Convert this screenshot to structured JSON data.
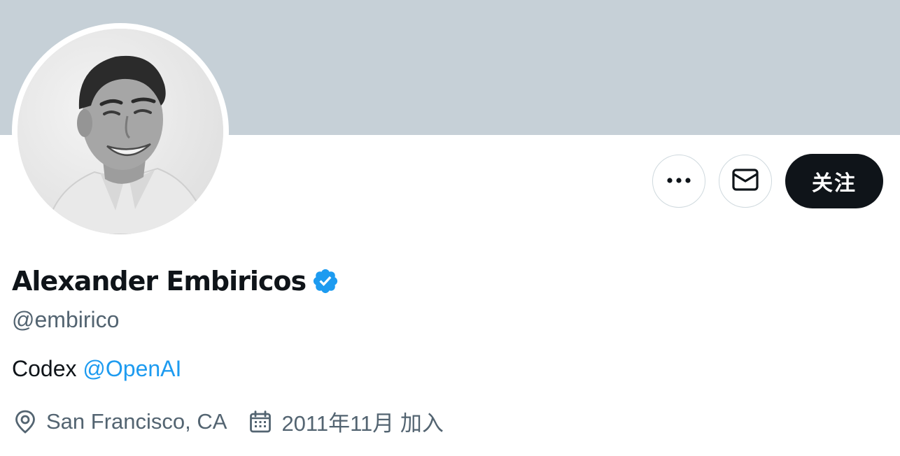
{
  "profile": {
    "display_name": "Alexander Embiricos",
    "handle": "@embirico",
    "verified_icon": "verified-badge-icon",
    "bio_text": "Codex",
    "bio_mention": "@OpenAI",
    "location": "San Francisco, CA",
    "joined": "2011年11月 加入"
  },
  "actions": {
    "more_icon": "more-horizontal-icon",
    "message_icon": "envelope-icon",
    "follow_label": "关注"
  },
  "colors": {
    "banner": "#c6d0d7",
    "accent": "#1d9bf0",
    "text_primary": "#0f1419",
    "text_secondary": "#536471",
    "follow_bg": "#0f1419"
  }
}
